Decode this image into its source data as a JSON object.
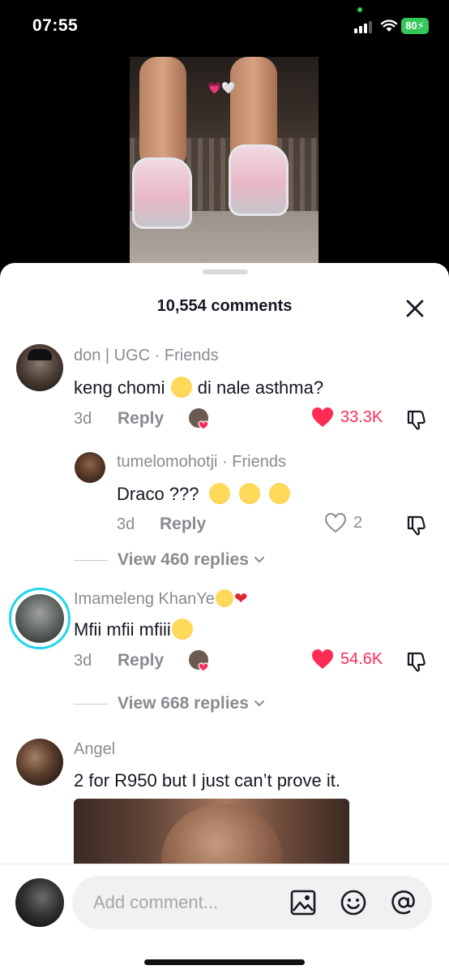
{
  "status_bar": {
    "time": "07:55",
    "battery": "80"
  },
  "video": {
    "caption": "💗🤍"
  },
  "sheet": {
    "title": "10,554 comments"
  },
  "comments": [
    {
      "username": "don | UGC",
      "relation": "Friends",
      "text_before": "keng chomi",
      "text_after": "di nale asthma?",
      "age": "3d",
      "reply_label": "Reply",
      "likes": "33.3K",
      "liked": true
    },
    {
      "username": "tumelomohotji",
      "relation": "Friends",
      "text": "Draco ???",
      "age": "3d",
      "reply_label": "Reply",
      "likes": "2",
      "liked": false
    },
    {
      "username": "Imameleng KhanYe",
      "text": "Mfii mfii mfiii",
      "age": "3d",
      "reply_label": "Reply",
      "likes": "54.6K",
      "liked": true
    },
    {
      "username": "Angel",
      "text": "2 for R950 but I just can’t prove it."
    }
  ],
  "view_replies": [
    {
      "label": "View 460 replies"
    },
    {
      "label": "View 668 replies"
    }
  ],
  "composer": {
    "placeholder": "Add comment..."
  },
  "colors": {
    "like_red": "#fe2c55",
    "muted": "#8a8b91",
    "text": "#161823",
    "ring": "#20d5ec"
  }
}
